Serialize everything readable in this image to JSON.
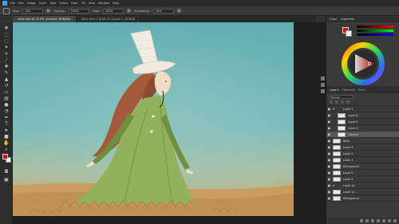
{
  "app": {
    "menu": [
      "File",
      "Edit",
      "Image",
      "Layer",
      "Type",
      "Select",
      "Filter",
      "3D",
      "View",
      "Window",
      "Help"
    ],
    "options": {
      "size_label": "Size:",
      "size_value": "100",
      "opacity_label": "Opacity:",
      "opacity_value": "100%",
      "flow_label": "Flow:",
      "flow_value": "100%",
      "smoothing_label": "Smoothing:",
      "smoothing_value": "10%"
    }
  },
  "tabs": [
    {
      "label": "witch.psd @ 33.3% (Colored, RGB/8#)",
      "active": true
    },
    {
      "label": "Sans titre-1 @ 66.7% (Layer 1, RGB/8)",
      "active": false
    }
  ],
  "tools": [
    "move-icon",
    "marquee-icon",
    "lasso-icon",
    "wand-icon",
    "crop-icon",
    "eyedropper-icon",
    "healing-icon",
    "brush-icon",
    "stamp-icon",
    "history-icon",
    "eraser-icon",
    "gradient-icon",
    "blur-icon",
    "dodge-icon",
    "pen-icon",
    "type-icon",
    "path-icon",
    "shape-icon",
    "hand-icon",
    "zoom-icon"
  ],
  "colors": {
    "foreground": "#c21515",
    "background": "#f2f2f2",
    "sky": "#6fb3b8",
    "ground": "#c79a5a",
    "dress": "#8fae58",
    "hair": "#a85f3c"
  },
  "color_panel": {
    "tabs": [
      "Color",
      "Swatches"
    ]
  },
  "layers_panel": {
    "tabs": [
      "Layers",
      "Channels",
      "Paths"
    ],
    "blend_mode": "Normal",
    "layers": [
      {
        "name": "Layer 7",
        "type": "folder",
        "selected": false,
        "indent": false
      },
      {
        "name": "Layer 6",
        "type": "layer",
        "selected": false,
        "indent": true
      },
      {
        "name": "Layer 5",
        "type": "layer",
        "selected": false,
        "indent": true
      },
      {
        "name": "Layer 4",
        "type": "layer",
        "selected": false,
        "indent": true
      },
      {
        "name": "Colored",
        "type": "layer",
        "selected": true,
        "indent": true
      },
      {
        "name": "Base",
        "type": "layer",
        "selected": false,
        "indent": false
      },
      {
        "name": "Layer 3",
        "type": "layer",
        "selected": false,
        "indent": false
      },
      {
        "name": "Layer 2",
        "type": "layer",
        "selected": false,
        "indent": false
      },
      {
        "name": "Layer 1",
        "type": "layer",
        "selected": false,
        "indent": false
      },
      {
        "name": "Background",
        "type": "layer",
        "selected": false,
        "indent": false
      },
      {
        "name": "Layer 8",
        "type": "layer",
        "selected": false,
        "indent": false
      },
      {
        "name": "Layer 9",
        "type": "layer",
        "selected": false,
        "indent": false
      },
      {
        "name": "Layer 10",
        "type": "folder",
        "selected": false,
        "indent": false
      },
      {
        "name": "Layer 11",
        "type": "layer",
        "selected": false,
        "indent": false
      },
      {
        "name": "Background",
        "type": "layer",
        "selected": false,
        "indent": false
      }
    ]
  }
}
